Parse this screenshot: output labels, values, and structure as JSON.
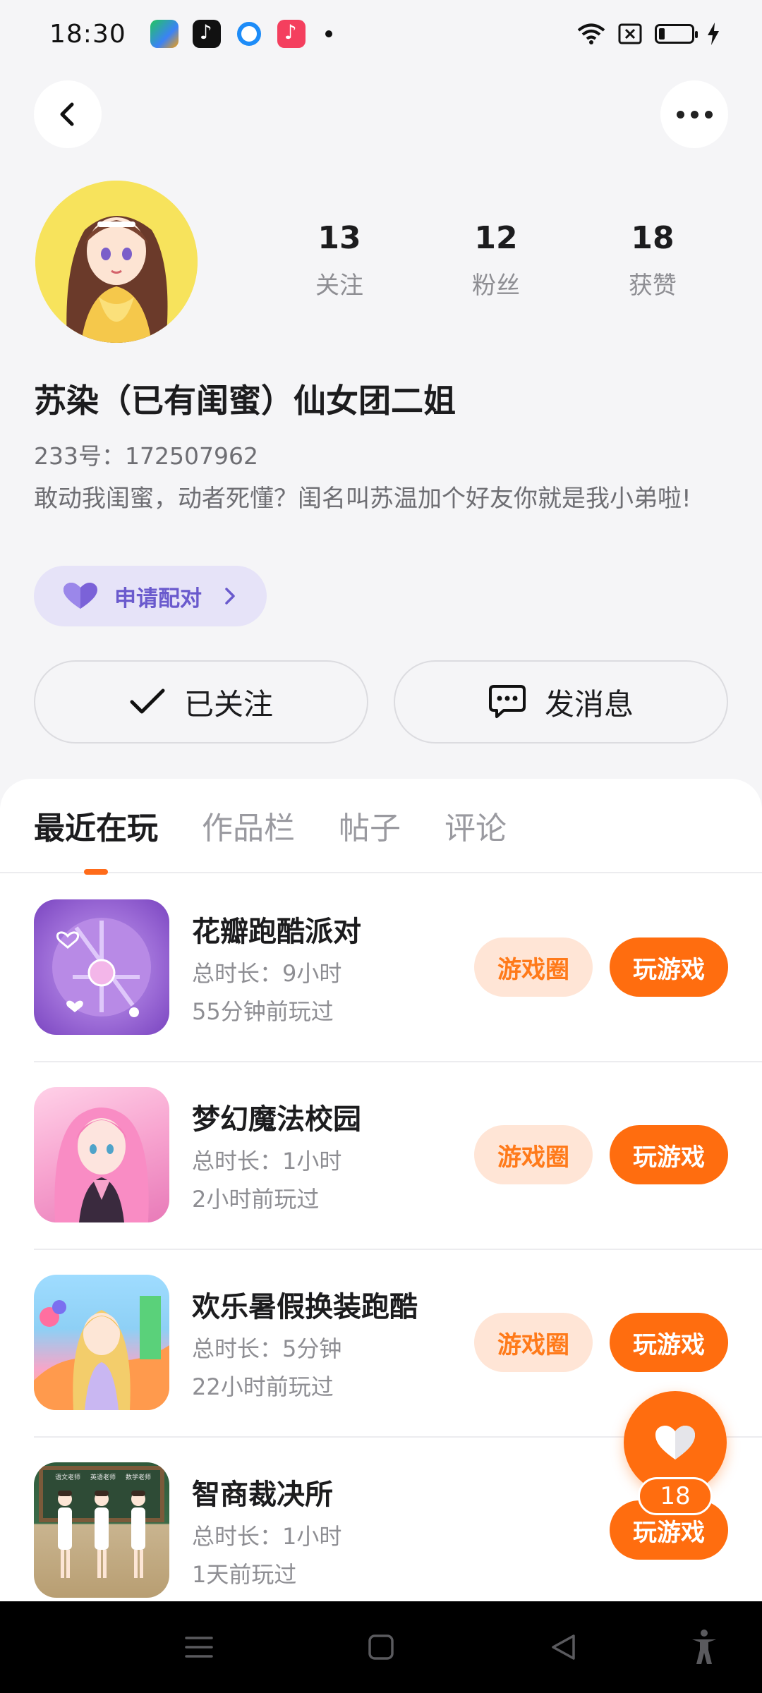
{
  "status_bar": {
    "time": "18:30"
  },
  "profile": {
    "following_count": "13",
    "following_label": "关注",
    "followers_count": "12",
    "followers_label": "粉丝",
    "likes_count": "18",
    "likes_label": "获赞",
    "nickname": "苏染（已有闺蜜）仙女团二姐",
    "uid": "233号：172507962",
    "bio": "敢动我闺蜜，动者死懂？闺名叫苏温加个好友你就是我小弟啦!",
    "pair_label": "申请配对"
  },
  "actions": {
    "follow_label": "已关注",
    "message_label": "发消息"
  },
  "tabs": [
    {
      "label": "最近在玩"
    },
    {
      "label": "作品栏"
    },
    {
      "label": "帖子"
    },
    {
      "label": "评论"
    }
  ],
  "games": [
    {
      "title": "花瓣跑酷派对",
      "duration": "总时长：9小时",
      "last_played": "55分钟前玩过",
      "circle_label": "游戏圈",
      "play_label": "玩游戏"
    },
    {
      "title": "梦幻魔法校园",
      "duration": "总时长：1小时",
      "last_played": "2小时前玩过",
      "circle_label": "游戏圈",
      "play_label": "玩游戏"
    },
    {
      "title": "欢乐暑假换装跑酷",
      "duration": "总时长：5分钟",
      "last_played": "22小时前玩过",
      "circle_label": "游戏圈",
      "play_label": "玩游戏"
    },
    {
      "title": "智商裁决所",
      "duration": "总时长：1小时",
      "last_played": "1天前玩过",
      "play_label": "玩游戏"
    }
  ],
  "thumb_texts": [
    "语文老师",
    "英语老师",
    "数学老师"
  ],
  "like_fab": {
    "count": "18"
  },
  "colors": {
    "accent": "#ff6d0f",
    "accent_light": "#ffe5d6",
    "pair_bg": "#e6e3f8",
    "pair_text": "#6a5acd"
  },
  "icons": {
    "back": "chevron-left-icon",
    "more": "more-dots-icon",
    "pair": "heart-icon",
    "follow": "check-icon",
    "message": "chat-bubble-icon",
    "like": "heart-icon"
  }
}
